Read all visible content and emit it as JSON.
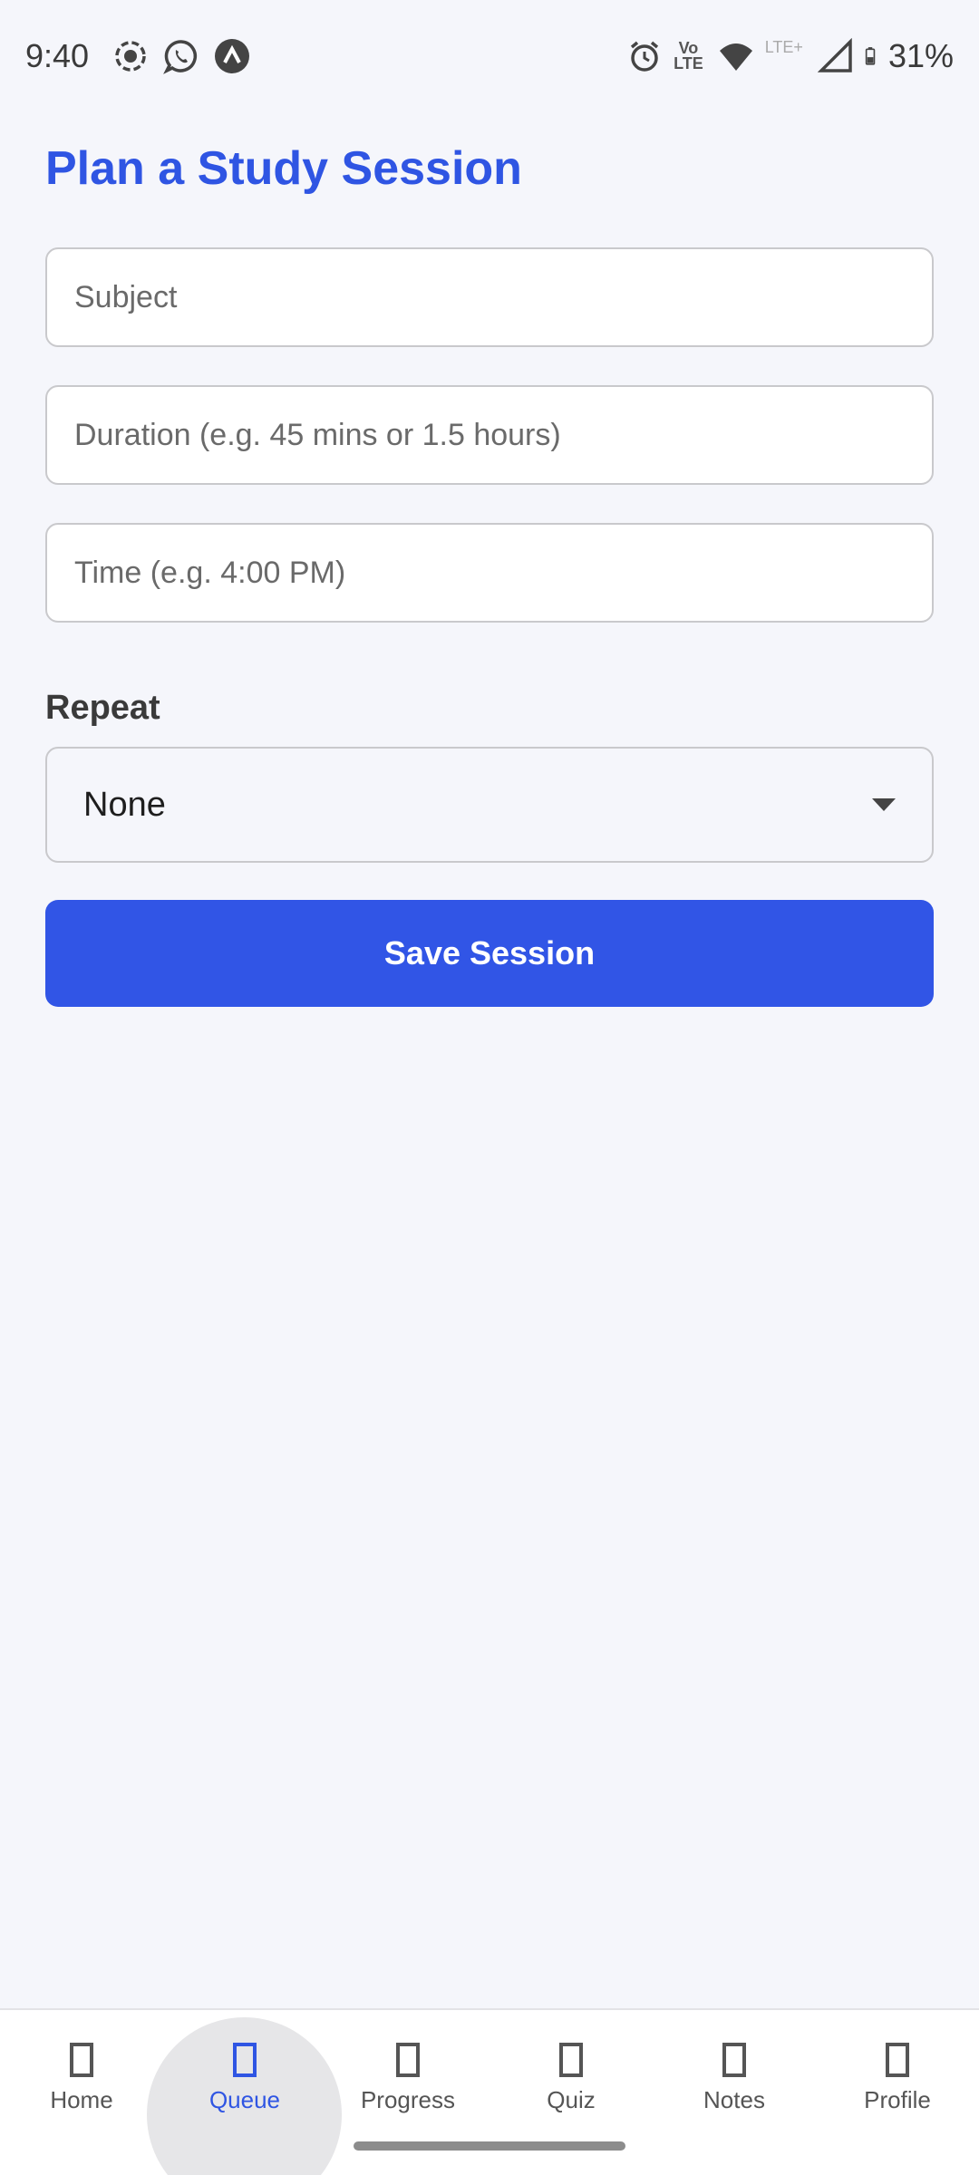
{
  "status_bar": {
    "time": "9:40",
    "left_icons": [
      "screen-record-icon",
      "whatsapp-icon",
      "app-arrow-icon"
    ],
    "right_icons": [
      "alarm-icon",
      "volte-icon",
      "wifi-icon",
      "lte-plus-icon",
      "signal-icon",
      "battery-icon"
    ],
    "volte_label": "Vo\nLTE",
    "lte_label": "LTE+",
    "battery": "31%"
  },
  "page": {
    "title": "Plan a Study Session"
  },
  "form": {
    "subject": {
      "placeholder": "Subject",
      "value": ""
    },
    "duration": {
      "placeholder": "Duration (e.g. 45 mins or 1.5 hours)",
      "value": ""
    },
    "time": {
      "placeholder": "Time (e.g. 4:00 PM)",
      "value": ""
    },
    "repeat_label": "Repeat",
    "repeat_value": "None",
    "save_label": "Save Session"
  },
  "nav": {
    "items": [
      {
        "label": "Home",
        "active": false
      },
      {
        "label": "Queue",
        "active": true
      },
      {
        "label": "Progress",
        "active": false
      },
      {
        "label": "Quiz",
        "active": false
      },
      {
        "label": "Notes",
        "active": false
      },
      {
        "label": "Profile",
        "active": false
      }
    ]
  },
  "colors": {
    "accent": "#2f55e3",
    "button": "#3155e6",
    "background": "#f5f6fb"
  }
}
